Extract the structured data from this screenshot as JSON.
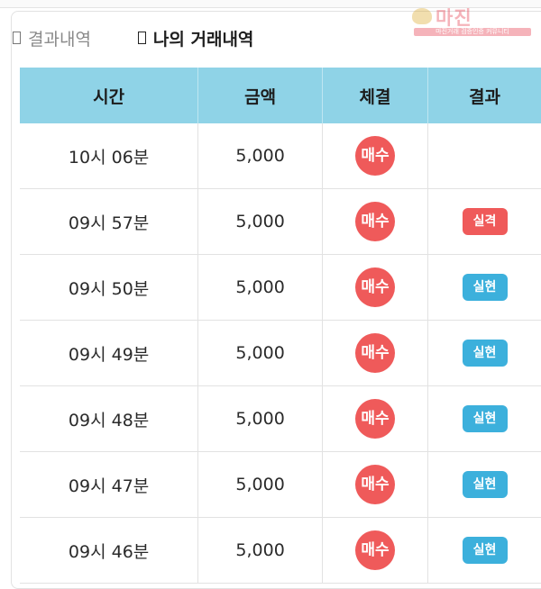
{
  "tabs": [
    {
      "label": "결과내역",
      "icon": "document-icon",
      "active": false
    },
    {
      "label": "나의 거래내역",
      "icon": "document-icon",
      "active": true
    }
  ],
  "watermark": {
    "name": "마진",
    "slogan": "마진거래 검증인증 커뮤니티"
  },
  "table": {
    "headers": [
      "시간",
      "금액",
      "체결",
      "결과"
    ],
    "rows": [
      {
        "time": "10시 06분",
        "amount": "5,000",
        "execution": "매수",
        "result": "",
        "result_type": "none"
      },
      {
        "time": "09시 57분",
        "amount": "5,000",
        "execution": "매수",
        "result": "실격",
        "result_type": "fail"
      },
      {
        "time": "09시 50분",
        "amount": "5,000",
        "execution": "매수",
        "result": "실현",
        "result_type": "success"
      },
      {
        "time": "09시 49분",
        "amount": "5,000",
        "execution": "매수",
        "result": "실현",
        "result_type": "success"
      },
      {
        "time": "09시 48분",
        "amount": "5,000",
        "execution": "매수",
        "result": "실현",
        "result_type": "success"
      },
      {
        "time": "09시 47분",
        "amount": "5,000",
        "execution": "매수",
        "result": "실현",
        "result_type": "success"
      },
      {
        "time": "09시 46분",
        "amount": "5,000",
        "execution": "매수",
        "result": "실현",
        "result_type": "success"
      }
    ]
  },
  "colors": {
    "header_bg": "#8fd3e7",
    "buy": "#ef5a5a",
    "fail": "#ef5a5a",
    "success": "#3cb0dc"
  }
}
